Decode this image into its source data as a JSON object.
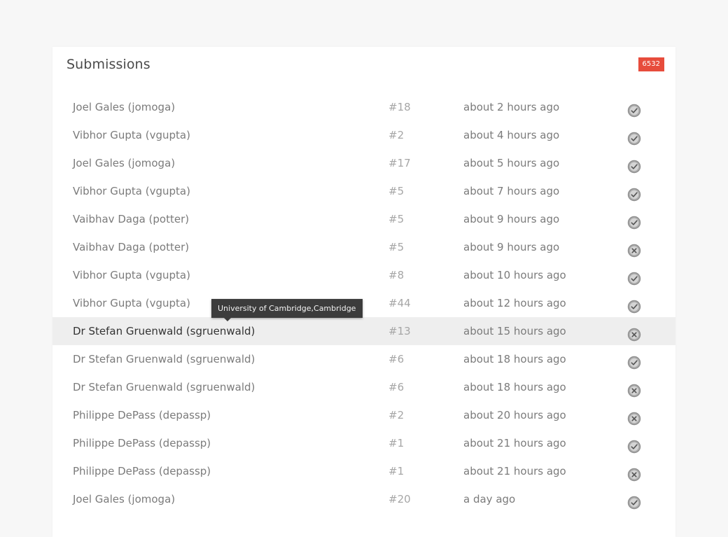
{
  "panel": {
    "title": "Submissions",
    "badge": "6532"
  },
  "colors": {
    "badge_background": "#e74c3c",
    "row_highlight": "#eeeeee",
    "tooltip_background": "#3c3c3c"
  },
  "tooltip": {
    "text": "University of Cambridge,Cambridge"
  },
  "submissions": [
    {
      "user": "Joel Gales (jomoga)",
      "problem": "#18",
      "time": "about 2 hours ago",
      "status": "accepted"
    },
    {
      "user": "Vibhor Gupta (vgupta)",
      "problem": "#2",
      "time": "about 4 hours ago",
      "status": "accepted"
    },
    {
      "user": "Joel Gales (jomoga)",
      "problem": "#17",
      "time": "about 5 hours ago",
      "status": "accepted"
    },
    {
      "user": "Vibhor Gupta (vgupta)",
      "problem": "#5",
      "time": "about 7 hours ago",
      "status": "accepted"
    },
    {
      "user": "Vaibhav Daga (potter)",
      "problem": "#5",
      "time": "about 9 hours ago",
      "status": "accepted"
    },
    {
      "user": "Vaibhav Daga (potter)",
      "problem": "#5",
      "time": "about 9 hours ago",
      "status": "rejected"
    },
    {
      "user": "Vibhor Gupta (vgupta)",
      "problem": "#8",
      "time": "about 10 hours ago",
      "status": "accepted"
    },
    {
      "user": "Vibhor Gupta (vgupta)",
      "problem": "#44",
      "time": "about 12 hours ago",
      "status": "accepted"
    },
    {
      "user": "Dr Stefan Gruenwald (sgruenwald)",
      "problem": "#13",
      "time": "about 15 hours ago",
      "status": "rejected",
      "highlighted": true
    },
    {
      "user": "Dr Stefan Gruenwald (sgruenwald)",
      "problem": "#6",
      "time": "about 18 hours ago",
      "status": "accepted"
    },
    {
      "user": "Dr Stefan Gruenwald (sgruenwald)",
      "problem": "#6",
      "time": "about 18 hours ago",
      "status": "rejected"
    },
    {
      "user": "Philippe DePass (depassp)",
      "problem": "#2",
      "time": "about 20 hours ago",
      "status": "rejected"
    },
    {
      "user": "Philippe DePass (depassp)",
      "problem": "#1",
      "time": "about 21 hours ago",
      "status": "accepted"
    },
    {
      "user": "Philippe DePass (depassp)",
      "problem": "#1",
      "time": "about 21 hours ago",
      "status": "rejected"
    },
    {
      "user": "Joel Gales (jomoga)",
      "problem": "#20",
      "time": "a day ago",
      "status": "accepted"
    }
  ],
  "icons": {
    "accepted": "check-circle-icon",
    "rejected": "x-circle-icon"
  }
}
